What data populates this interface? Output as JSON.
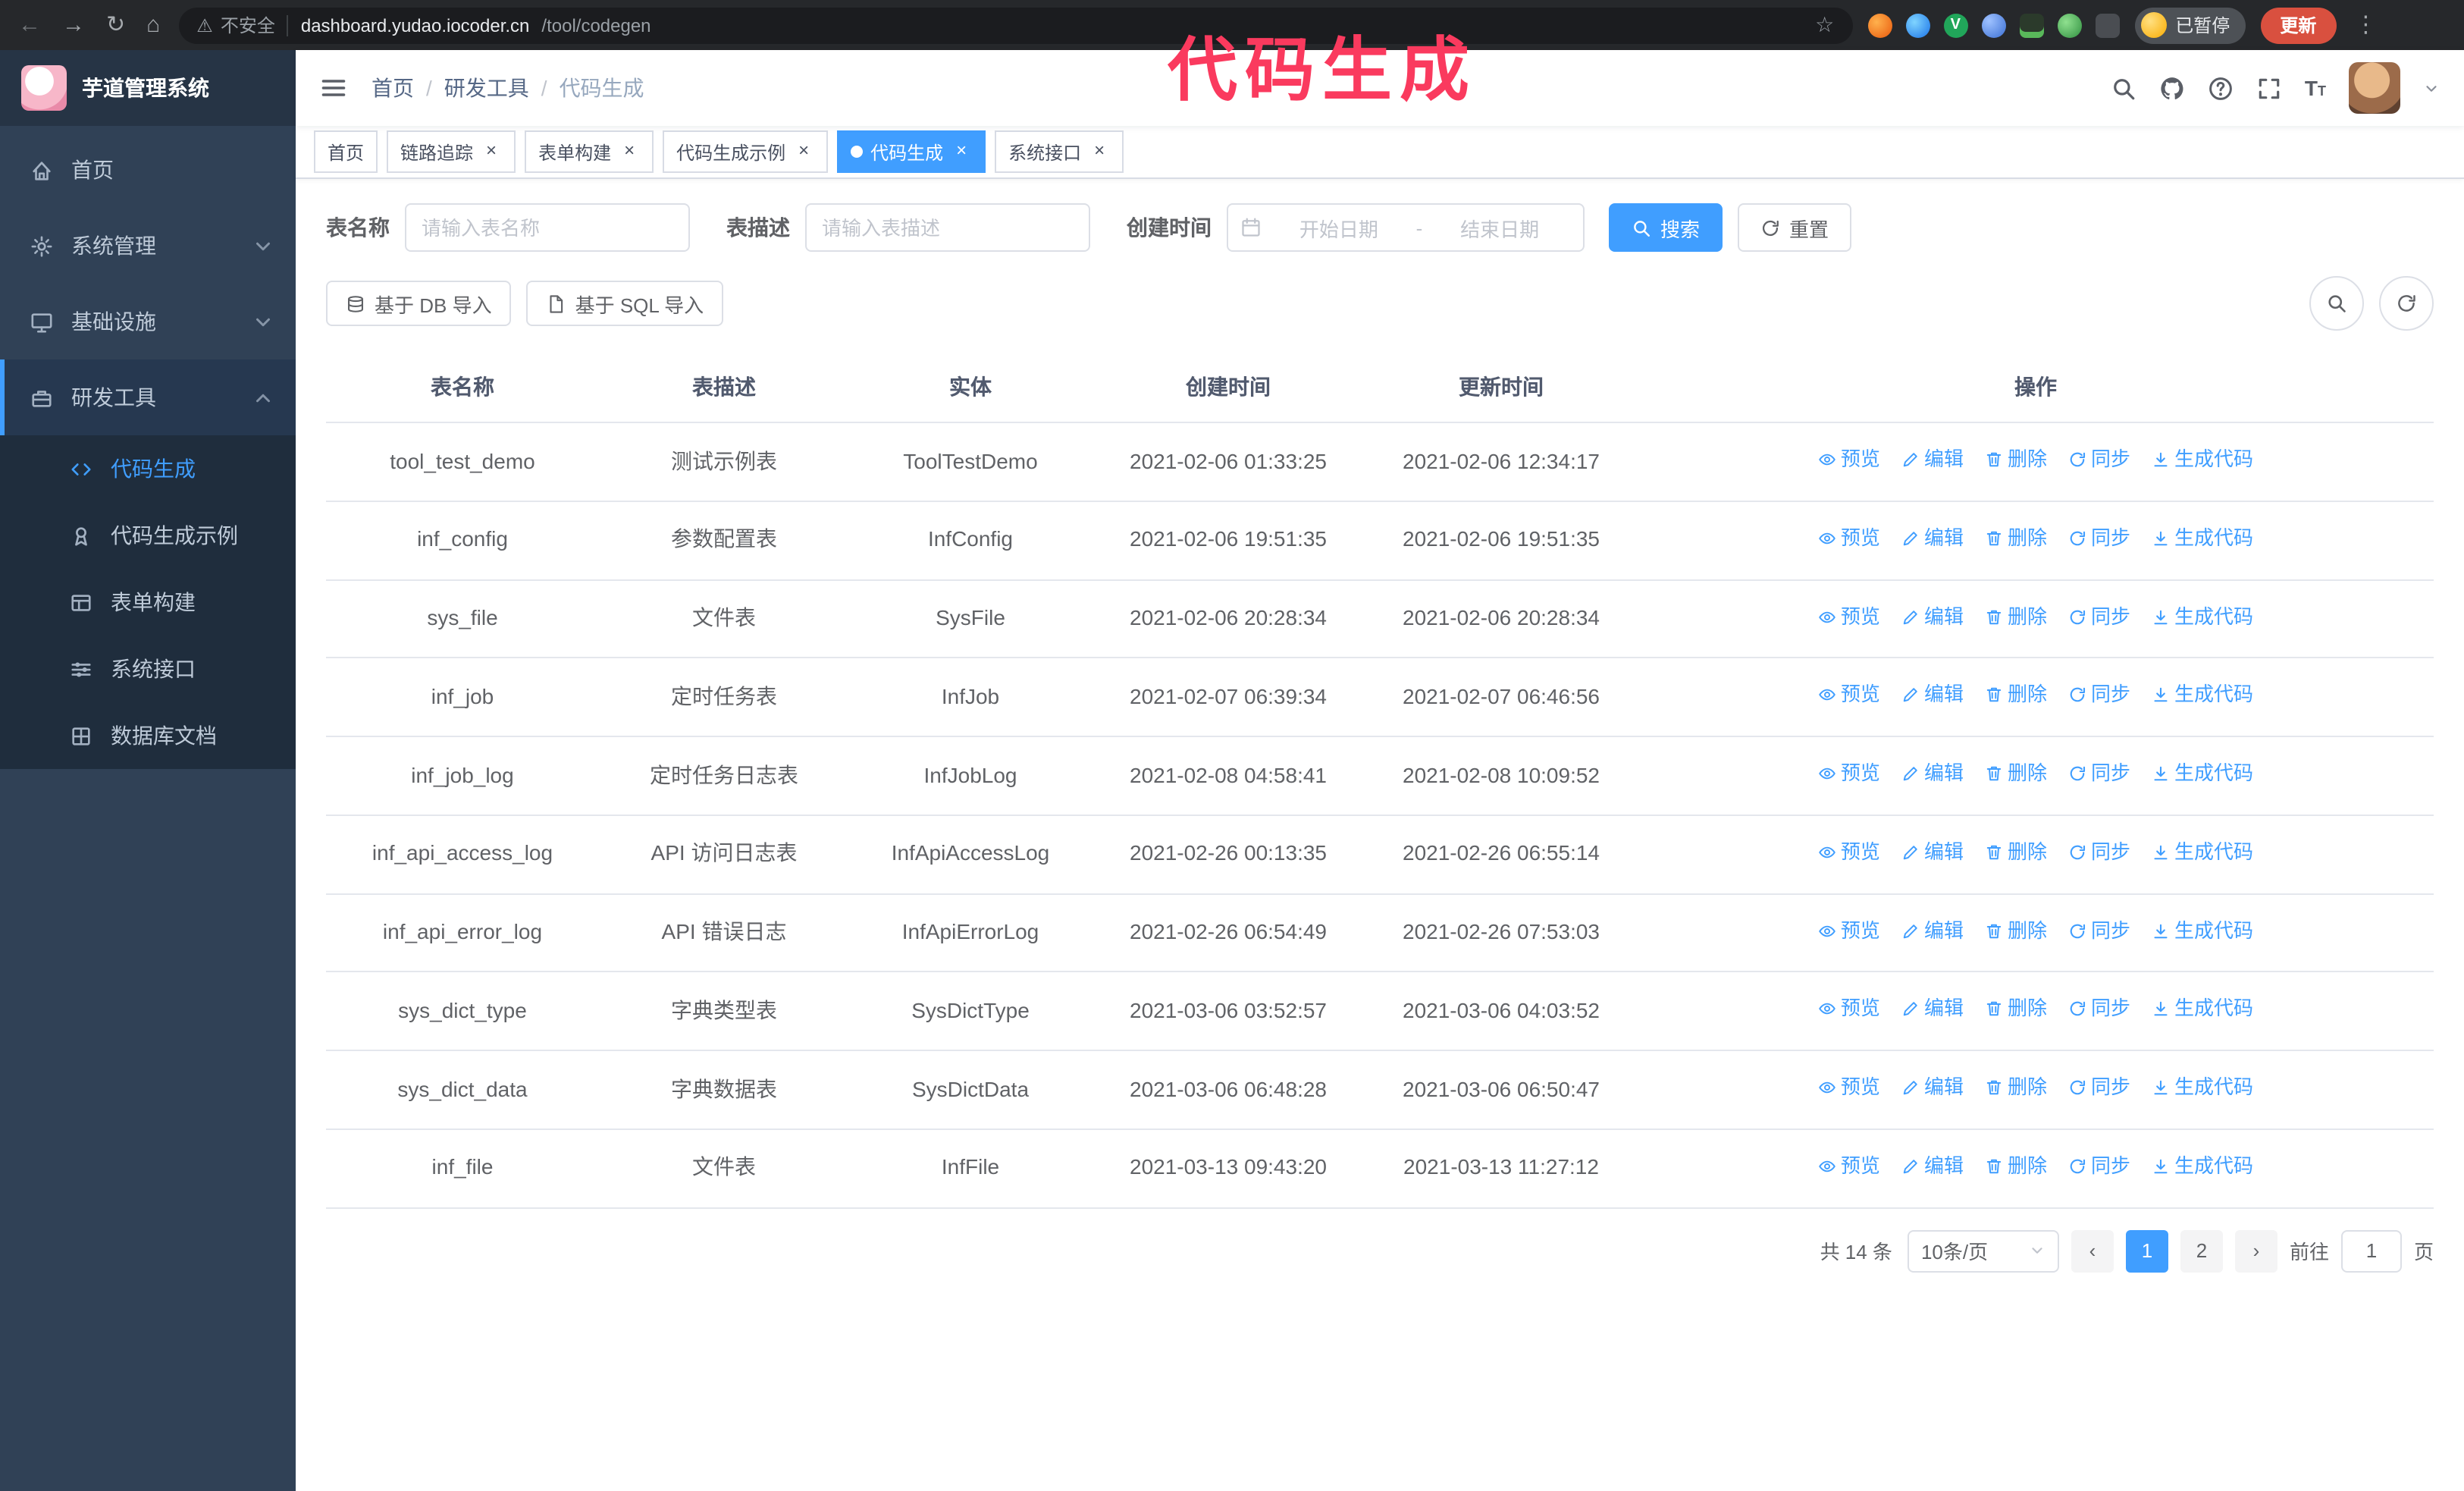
{
  "annotation": {
    "text": "代码生成",
    "color": "#fa3a5e"
  },
  "browser": {
    "security_label": "不安全",
    "url_host": "dashboard.yudao.iocoder.cn",
    "url_path": "/tool/codegen",
    "paused_badge": "已暂停",
    "update_button": "更新",
    "icons": [
      "back",
      "forward",
      "reload",
      "home",
      "warning",
      "star",
      "extensions",
      "menu-dots"
    ]
  },
  "app_title": "芋道管理系统",
  "sidebar": {
    "items": [
      {
        "label": "首页",
        "icon": "home",
        "state": "normal"
      },
      {
        "label": "系统管理",
        "icon": "gear",
        "state": "collapsed"
      },
      {
        "label": "基础设施",
        "icon": "monitor",
        "state": "collapsed"
      },
      {
        "label": "研发工具",
        "icon": "tool",
        "state": "expanded",
        "children": [
          {
            "label": "代码生成",
            "icon": "code",
            "active": true
          },
          {
            "label": "代码生成示例",
            "icon": "badge",
            "active": false
          },
          {
            "label": "表单构建",
            "icon": "form",
            "active": false
          },
          {
            "label": "系统接口",
            "icon": "api",
            "active": false
          },
          {
            "label": "数据库文档",
            "icon": "db",
            "active": false
          }
        ]
      }
    ]
  },
  "breadcrumb": [
    "首页",
    "研发工具",
    "代码生成"
  ],
  "breadcrumb_separator": "/",
  "navbar_icons": [
    "search",
    "github",
    "help",
    "fullscreen",
    "font-size",
    "avatar",
    "caret-down"
  ],
  "tags": [
    {
      "label": "首页",
      "closable": false,
      "active": false
    },
    {
      "label": "链路追踪",
      "closable": true,
      "active": false
    },
    {
      "label": "表单构建",
      "closable": true,
      "active": false
    },
    {
      "label": "代码生成示例",
      "closable": true,
      "active": false
    },
    {
      "label": "代码生成",
      "closable": true,
      "active": true
    },
    {
      "label": "系统接口",
      "closable": true,
      "active": false
    }
  ],
  "filters": {
    "table_name_label": "表名称",
    "table_name_placeholder": "请输入表名称",
    "table_desc_label": "表描述",
    "table_desc_placeholder": "请输入表描述",
    "create_time_label": "创建时间",
    "date_start_placeholder": "开始日期",
    "date_separator": "-",
    "date_end_placeholder": "结束日期",
    "search_button": "搜索",
    "reset_button": "重置"
  },
  "toolbar": {
    "import_db_button": "基于 DB 导入",
    "import_sql_button": "基于 SQL 导入"
  },
  "table": {
    "columns": [
      "表名称",
      "表描述",
      "实体",
      "创建时间",
      "更新时间",
      "操作"
    ],
    "actions": [
      {
        "id": "preview",
        "label": "预览",
        "icon": "eye"
      },
      {
        "id": "edit",
        "label": "编辑",
        "icon": "edit"
      },
      {
        "id": "delete",
        "label": "删除",
        "icon": "del"
      },
      {
        "id": "sync",
        "label": "同步",
        "icon": "sync"
      },
      {
        "id": "generate-code",
        "label": "生成代码",
        "icon": "down"
      }
    ],
    "rows": [
      {
        "name": "tool_test_demo",
        "desc": "测试示例表",
        "entity": "ToolTestDemo",
        "created": "2021-02-06 01:33:25",
        "updated": "2021-02-06 12:34:17"
      },
      {
        "name": "inf_config",
        "desc": "参数配置表",
        "entity": "InfConfig",
        "created": "2021-02-06 19:51:35",
        "updated": "2021-02-06 19:51:35"
      },
      {
        "name": "sys_file",
        "desc": "文件表",
        "entity": "SysFile",
        "created": "2021-02-06 20:28:34",
        "updated": "2021-02-06 20:28:34"
      },
      {
        "name": "inf_job",
        "desc": "定时任务表",
        "entity": "InfJob",
        "created": "2021-02-07 06:39:34",
        "updated": "2021-02-07 06:46:56"
      },
      {
        "name": "inf_job_log",
        "desc": "定时任务日志表",
        "entity": "InfJobLog",
        "created": "2021-02-08 04:58:41",
        "updated": "2021-02-08 10:09:52"
      },
      {
        "name": "inf_api_access_log",
        "desc": "API 访问日志表",
        "entity": "InfApiAccessLog",
        "created": "2021-02-26 00:13:35",
        "updated": "2021-02-26 06:55:14"
      },
      {
        "name": "inf_api_error_log",
        "desc": "API 错误日志",
        "entity": "InfApiErrorLog",
        "created": "2021-02-26 06:54:49",
        "updated": "2021-02-26 07:53:03"
      },
      {
        "name": "sys_dict_type",
        "desc": "字典类型表",
        "entity": "SysDictType",
        "created": "2021-03-06 03:52:57",
        "updated": "2021-03-06 04:03:52"
      },
      {
        "name": "sys_dict_data",
        "desc": "字典数据表",
        "entity": "SysDictData",
        "created": "2021-03-06 06:48:28",
        "updated": "2021-03-06 06:50:47"
      },
      {
        "name": "inf_file",
        "desc": "文件表",
        "entity": "InfFile",
        "created": "2021-03-13 09:43:20",
        "updated": "2021-03-13 11:27:12"
      }
    ]
  },
  "pagination": {
    "total": "共 14 条",
    "page_size": "10条/页",
    "pages": [
      "1",
      "2"
    ],
    "active_page": "1",
    "goto_label": "前往",
    "goto_value": "1",
    "goto_suffix": "页"
  },
  "colors": {
    "primary": "#409eff",
    "sidebar_bg": "#304156",
    "sidebar_submenu_bg": "#1f2d3d",
    "annotation": "#fa3a5e",
    "update_button_bg": "#d9503f"
  }
}
